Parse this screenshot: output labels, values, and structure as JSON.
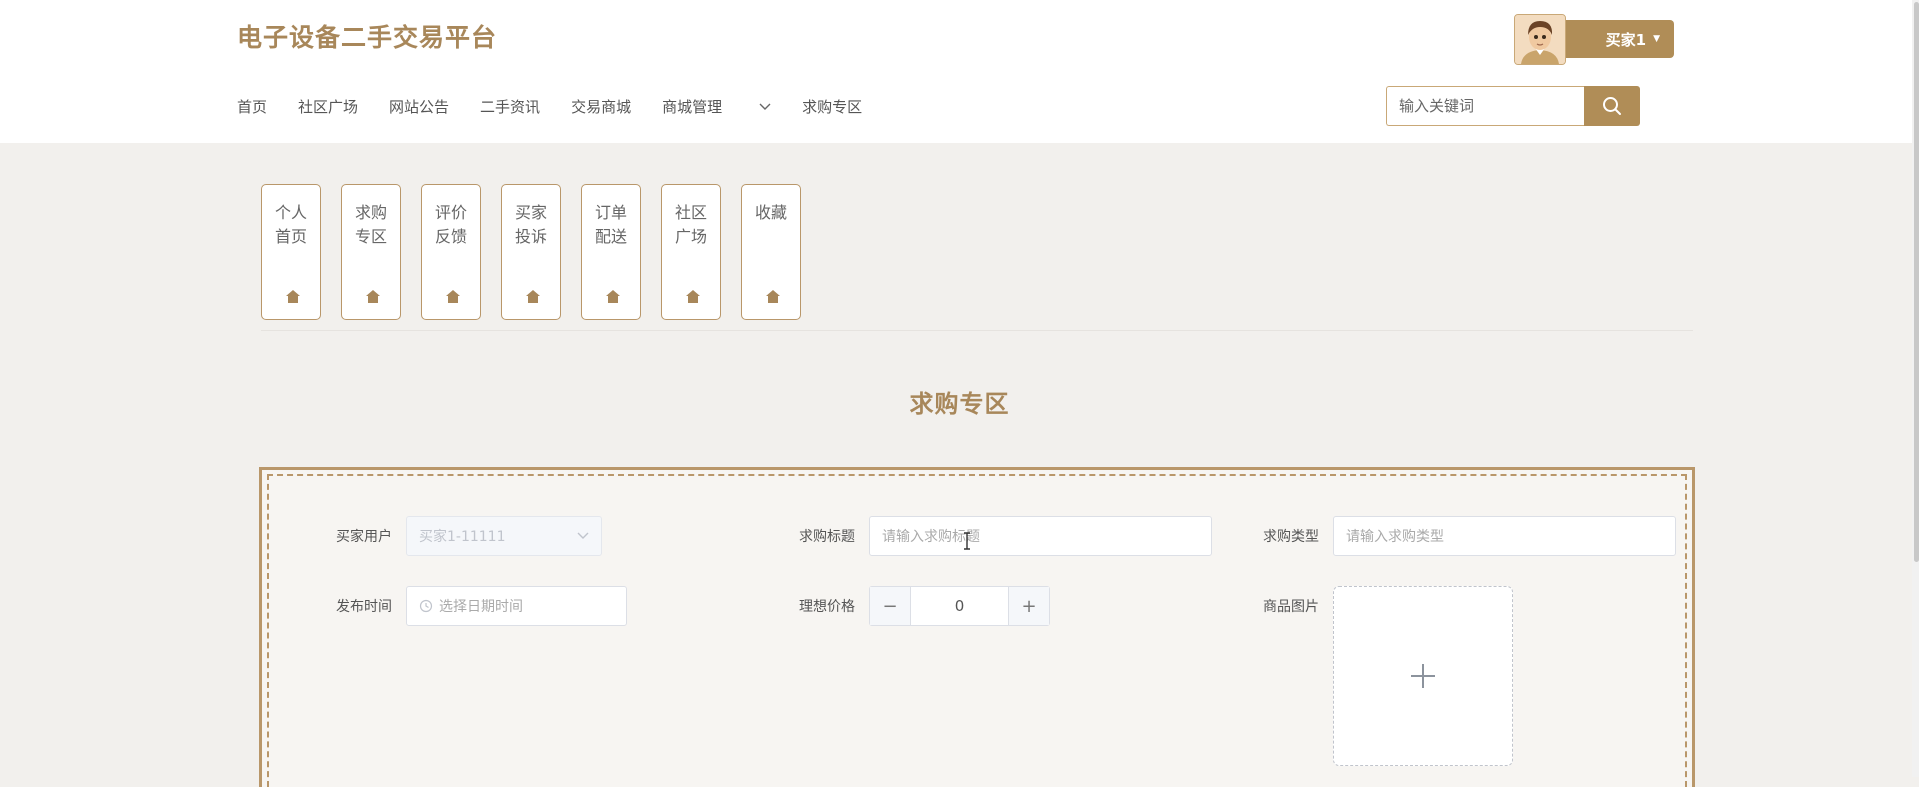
{
  "header": {
    "site_title": "电子设备二手交易平台",
    "user_name": "买家1",
    "nav": [
      "首页",
      "社区广场",
      "网站公告",
      "二手资讯",
      "交易商城",
      "商城管理",
      "求购专区"
    ],
    "search_placeholder": "输入关键词"
  },
  "cards": [
    {
      "label": "个人首页",
      "icon": "house-icon"
    },
    {
      "label": "求购专区",
      "icon": "house-icon"
    },
    {
      "label": "评价反馈",
      "icon": "house-icon"
    },
    {
      "label": "买家投诉",
      "icon": "house-icon"
    },
    {
      "label": "订单配送",
      "icon": "house-icon"
    },
    {
      "label": "社区广场",
      "icon": "house-icon"
    },
    {
      "label": "收藏",
      "icon": "house-icon"
    }
  ],
  "section_title": "求购专区",
  "form": {
    "buyer_user_label": "买家用户",
    "buyer_user_value": "买家1-11111",
    "title_label": "求购标题",
    "title_placeholder": "请输入求购标题",
    "type_label": "求购类型",
    "type_placeholder": "请输入求购类型",
    "publish_time_label": "发布时间",
    "publish_time_placeholder": "选择日期时间",
    "price_label": "理想价格",
    "price_value": "0",
    "image_label": "商品图片"
  },
  "colors": {
    "accent": "#b08d57",
    "title": "#a8875a",
    "background": "#f2f0ed"
  }
}
